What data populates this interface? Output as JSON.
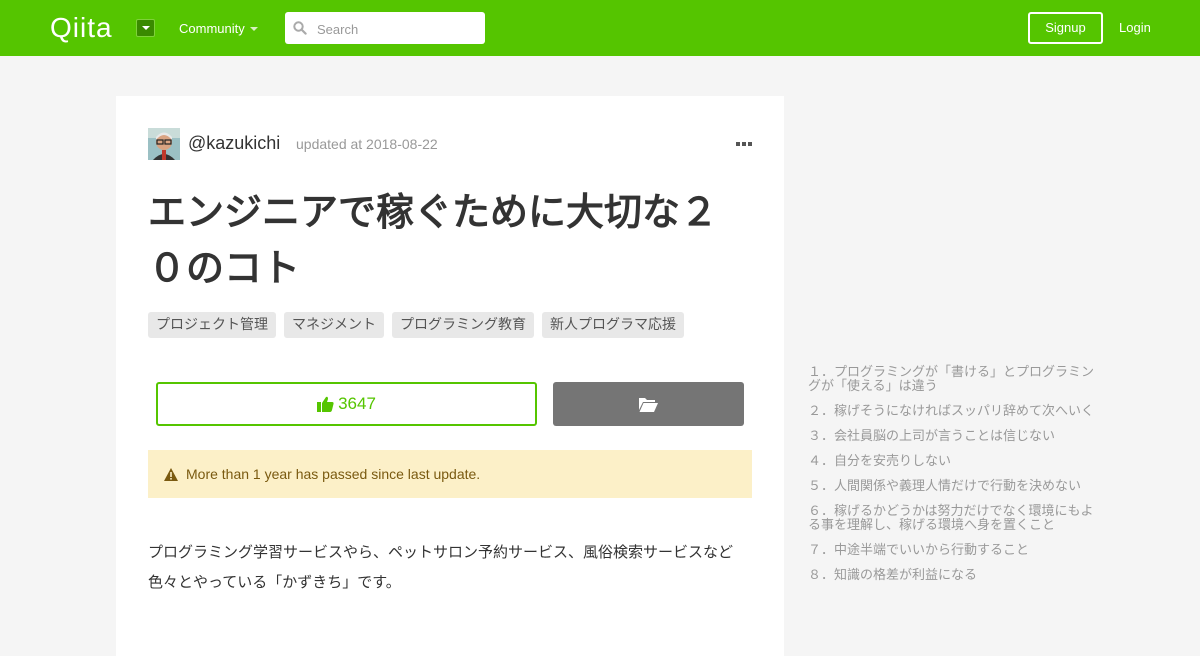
{
  "header": {
    "logo": "Qiita",
    "community_label": "Community",
    "search_placeholder": "Search",
    "signup_label": "Signup",
    "login_label": "Login"
  },
  "article": {
    "author": "@kazukichi",
    "updated": "updated at 2018-08-22",
    "title": "エンジニアで稼ぐために大切な２０のコト",
    "tags": [
      "プロジェクト管理",
      "マネジメント",
      "プログラミング教育",
      "新人プログラマ応援"
    ],
    "like_count": "3647",
    "alert": "More than 1 year has passed since last update.",
    "body": "プログラミング学習サービスやら、ペットサロン予約サービス、風俗検索サービスなど色々とやっている「かずきち」です。"
  },
  "toc": {
    "items": [
      "１．プログラミングが「書ける」とプログラミングが「使える」は違う",
      "２．稼げそうになければスッパリ辞めて次へいく",
      "３．会社員脳の上司が言うことは信じない",
      "４．自分を安売りしない",
      "５．人間関係や義理人情だけで行動を決めない",
      "６．稼げるかどうかは努力だけでなく環境にもよる事を理解し、稼げる環境へ身を置くこと",
      "７．中途半端でいいから行動すること",
      "８．知識の格差が利益になる"
    ]
  },
  "colors": {
    "brand": "#55c500",
    "alert_bg": "#fcf0c8",
    "stock_button": "#757575"
  }
}
